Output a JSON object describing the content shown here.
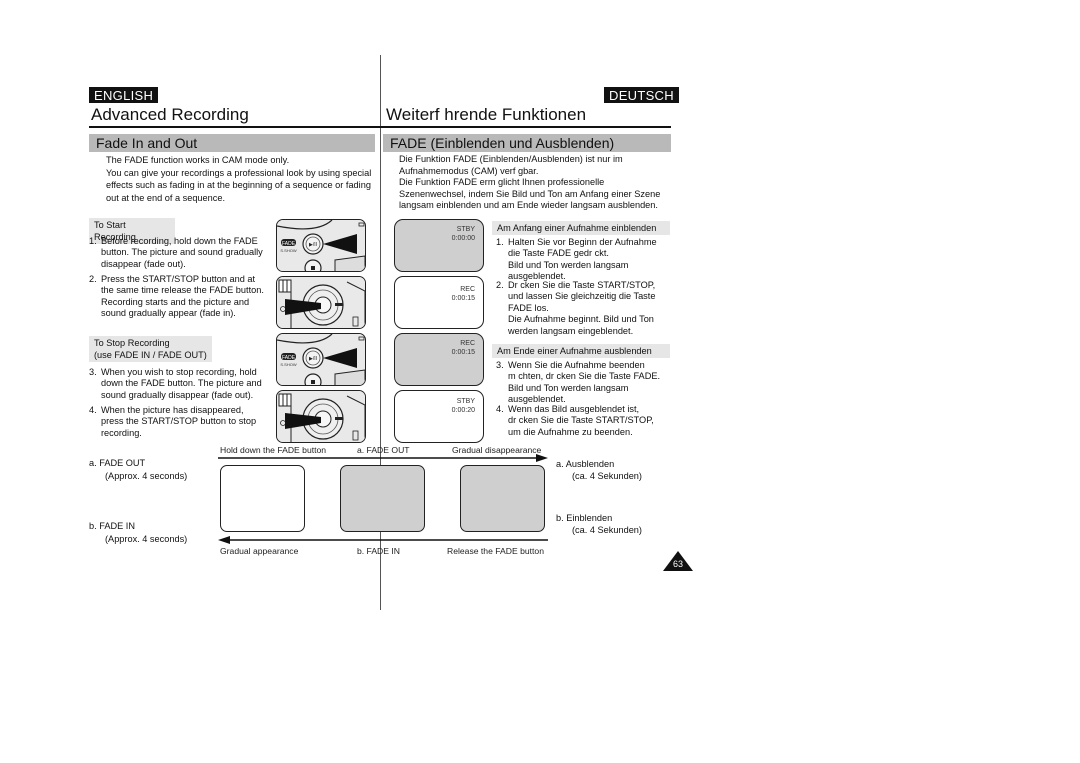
{
  "left": {
    "language": "ENGLISH",
    "title": "Advanced Recording",
    "section": "Fade In and Out",
    "intro": [
      "The FADE function works in CAM mode only.",
      "You can give your recordings a professional look by using special",
      "effects such as fading in at the beginning of a sequence or fading",
      "out at the end of a sequence."
    ],
    "start_heading": "To Start Recording",
    "start_steps": [
      {
        "num": "1.",
        "lines": [
          "Before recording, hold down the FADE",
          "button. The picture and sound gradually",
          "disappear (fade out)."
        ]
      },
      {
        "num": "2.",
        "lines": [
          "Press the START/STOP button and at",
          "the same time release the FADE button.",
          "Recording starts and the picture and",
          "sound gradually appear (fade in)."
        ]
      }
    ],
    "stop_heading": [
      "To Stop Recording",
      "(use FADE IN / FADE OUT)"
    ],
    "stop_steps": [
      {
        "num": "3.",
        "lines": [
          "When you wish to stop recording, hold",
          "down the FADE button. The picture and",
          "sound gradually disappear (fade out)."
        ]
      },
      {
        "num": "4.",
        "lines": [
          "When the picture has disappeared,",
          "press the START/STOP button to stop",
          "recording."
        ]
      }
    ],
    "fade_out": {
      "label": "a.  FADE OUT",
      "duration": "(Approx. 4 seconds)"
    },
    "fade_in": {
      "label": "b.  FADE IN",
      "duration": "(Approx. 4 seconds)"
    }
  },
  "right": {
    "language": "DEUTSCH",
    "title": "Weiterf hrende Funktionen",
    "section": "FADE (Einblenden und Ausblenden)",
    "intro": [
      "Die Funktion FADE (Einblenden/Ausblenden) ist nur im",
      "Aufnahmemodus (CAM) verf  gbar.",
      "Die Funktion FADE erm  glicht Ihnen professionelle",
      "Szenenwechsel, indem Sie Bild und Ton am Anfang einer Szene",
      "langsam einblenden und am Ende wieder langsam ausblenden."
    ],
    "start_heading": "Am Anfang einer Aufnahme einblenden",
    "start_steps": [
      {
        "num": "1.",
        "lines": [
          "Halten Sie vor Beginn der Aufnahme",
          "die Taste FADE gedr  ckt.",
          "Bild und Ton werden langsam",
          "ausgeblendet."
        ]
      },
      {
        "num": "2.",
        "lines": [
          "Dr  cken Sie die Taste START/STOP,",
          "und lassen Sie gleichzeitig die Taste",
          "FADE los.",
          "Die Aufnahme beginnt. Bild und Ton",
          "werden langsam eingeblendet."
        ]
      }
    ],
    "stop_heading": "Am Ende einer Aufnahme ausblenden",
    "stop_steps": [
      {
        "num": "3.",
        "lines": [
          "Wenn Sie die Aufnahme beenden",
          "m  chten, dr  cken Sie die Taste FADE.",
          "Bild und Ton werden langsam",
          "ausgeblendet."
        ]
      },
      {
        "num": "4.",
        "lines": [
          "Wenn das Bild ausgeblendet ist,",
          "dr  cken Sie die Taste START/STOP,",
          "um die Aufnahme zu beenden."
        ]
      }
    ],
    "fade_out": {
      "label": "a.  Ausblenden",
      "duration": "(ca. 4 Sekunden)"
    },
    "fade_in": {
      "label": "b.  Einblenden",
      "duration": "(ca. 4 Sekunden)"
    }
  },
  "screens": [
    {
      "mode": "STBY",
      "time": "0:00:00",
      "fill": "gray"
    },
    {
      "mode": "REC",
      "time": "0:00:15",
      "fill": "white"
    },
    {
      "mode": "REC",
      "time": "0:00:15",
      "fill": "gray"
    },
    {
      "mode": "STBY",
      "time": "0:00:20",
      "fill": "white"
    }
  ],
  "camera": {
    "fade_button_label": "FADE",
    "sub_label": "S.SHOW",
    "play_label": "▶/II"
  },
  "diagram": {
    "top_captions": [
      "Hold down the FADE button",
      "a. FADE OUT",
      "Gradual disappearance"
    ],
    "bottom_captions": [
      "Gradual appearance",
      "b. FADE IN",
      "Release the FADE button"
    ]
  },
  "page_number": "63"
}
